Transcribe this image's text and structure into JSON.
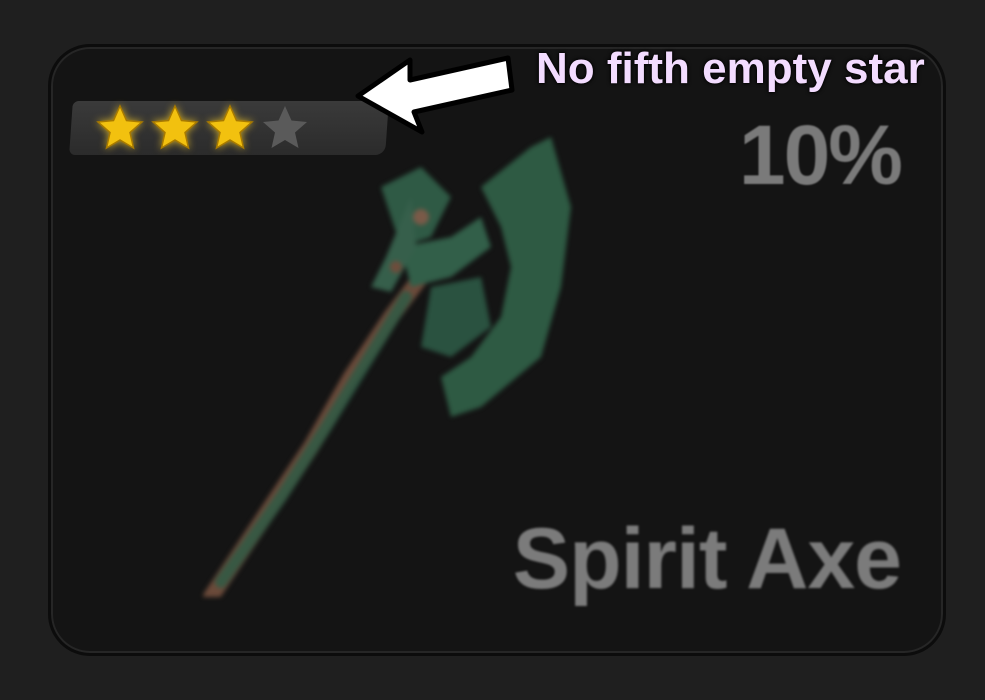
{
  "item_card": {
    "rarity": {
      "filled_stars": 3,
      "total_stars_shown": 4,
      "filled_color": "#f2c10f",
      "empty_color": "#5a5a5a"
    },
    "drop_chance": "10%",
    "name": "Spirit Axe",
    "icon": "spirit-axe-icon",
    "accent_color": "#2e5a43"
  },
  "annotation": {
    "text": "No fifth empty star",
    "color": "#f3dcff",
    "arrow_icon": "arrow-left-icon"
  }
}
